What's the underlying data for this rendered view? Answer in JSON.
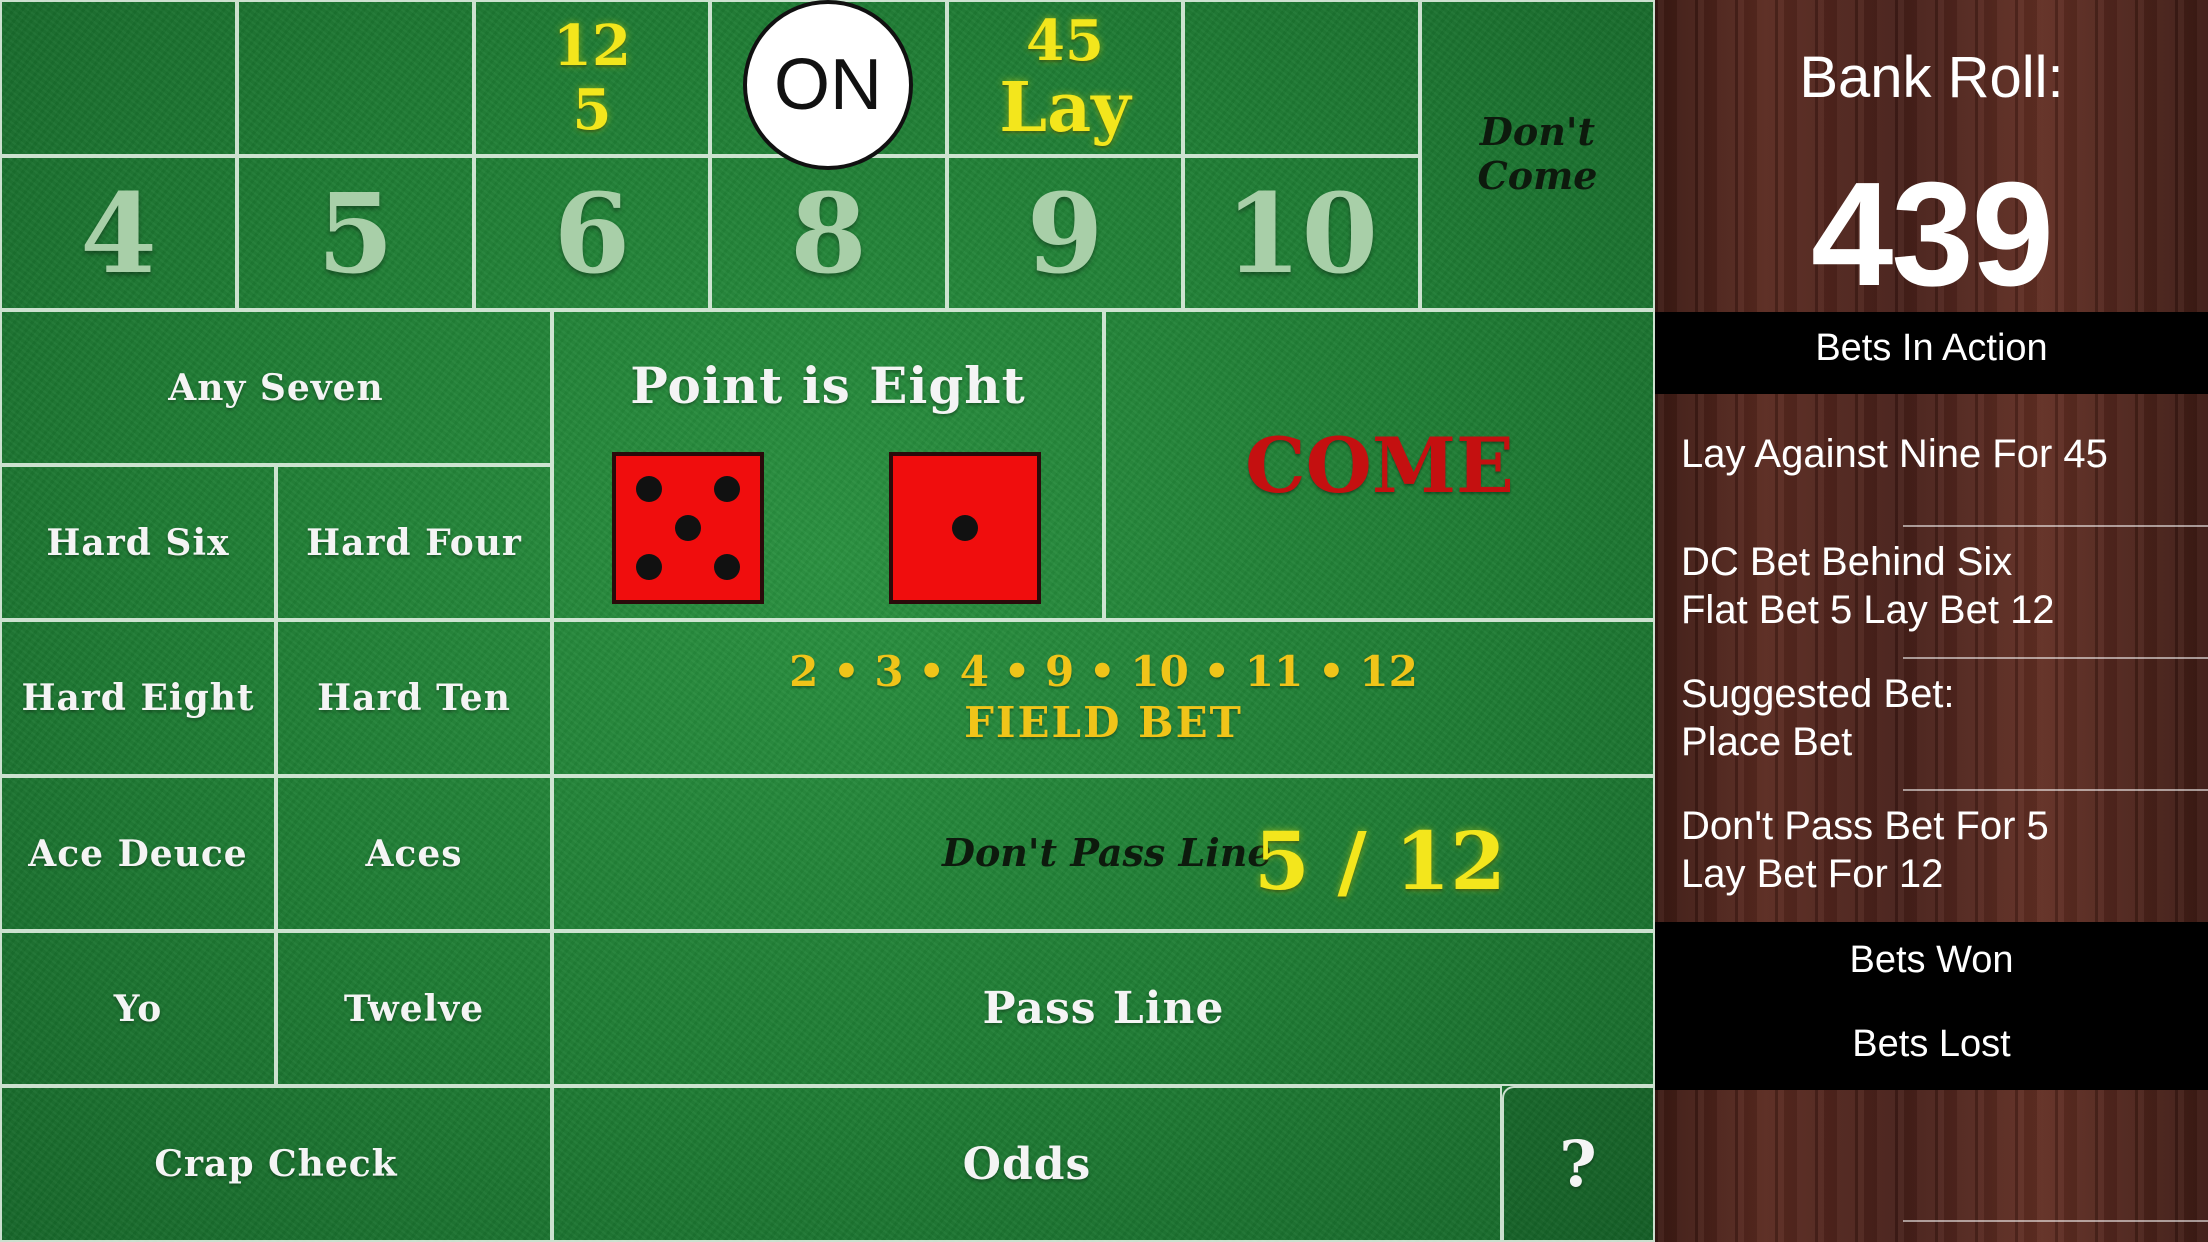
{
  "table": {
    "place_numbers": [
      "4",
      "5",
      "6",
      "8",
      "9",
      "10"
    ],
    "place_bets": {
      "six": {
        "top": "12",
        "bottom": "5"
      },
      "nine": {
        "top": "45",
        "bottom": "Lay"
      }
    },
    "puck_label": "ON",
    "dont_come": "Don't\nCome",
    "any_seven": "Any Seven",
    "point_text": "Point is Eight",
    "dice": [
      5,
      1
    ],
    "come": "COME",
    "hard_six": "Hard Six",
    "hard_four": "Hard Four",
    "hard_eight": "Hard Eight",
    "hard_ten": "Hard Ten",
    "field_numbers": "2 • 3 • 4 • 9 • 10 • 11 • 12",
    "field_bet": "FIELD BET",
    "ace_deuce": "Ace Deuce",
    "aces": "Aces",
    "dont_pass": "Don't Pass Line",
    "dont_pass_bet": "5 / 12",
    "yo": "Yo",
    "twelve": "Twelve",
    "pass_line": "Pass Line",
    "crap_check": "Crap Check",
    "odds": "Odds",
    "help": "?"
  },
  "sidebar": {
    "bankroll_label": "Bank Roll:",
    "bankroll_value": "439",
    "bets_in_action": "Bets In Action",
    "bets": [
      [
        "Lay Against Nine For 45"
      ],
      [
        "DC Bet Behind Six",
        "Flat Bet 5 Lay Bet 12"
      ],
      [
        "Suggested Bet:",
        "Place Bet"
      ],
      [
        "Don't Pass Bet For 5",
        "Lay Bet For 12"
      ]
    ],
    "bets_won": "Bets Won",
    "bets_lost": "Bets Lost"
  },
  "colors": {
    "felt": "#1f7d34",
    "highlight_yellow": "#f3e61c",
    "field_gold": "#f0c419",
    "come_red": "#c41010",
    "die_red": "#f00d0d"
  }
}
